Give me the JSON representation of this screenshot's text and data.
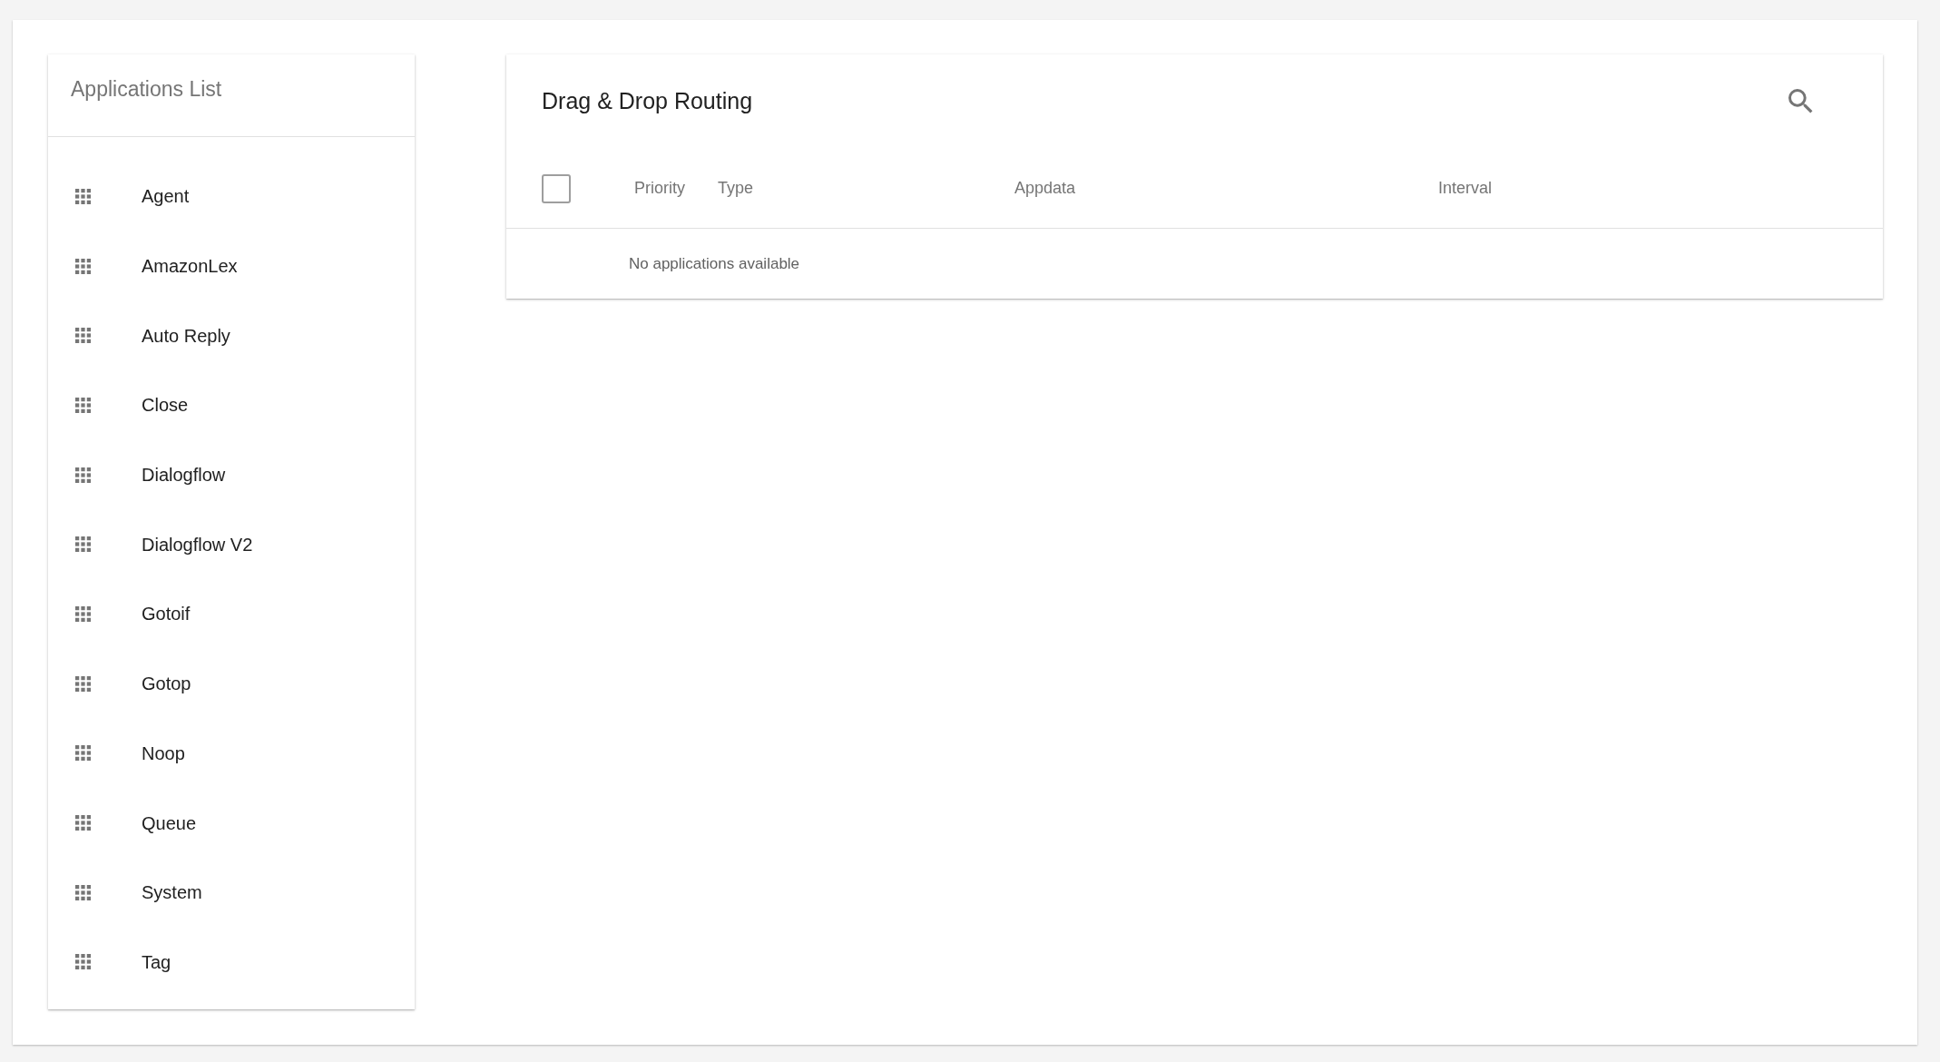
{
  "sidebar": {
    "title": "Applications List",
    "items": [
      {
        "label": "Agent"
      },
      {
        "label": "AmazonLex"
      },
      {
        "label": "Auto Reply"
      },
      {
        "label": "Close"
      },
      {
        "label": "Dialogflow"
      },
      {
        "label": "Dialogflow V2"
      },
      {
        "label": "Gotoif"
      },
      {
        "label": "Gotop"
      },
      {
        "label": "Noop"
      },
      {
        "label": "Queue"
      },
      {
        "label": "System"
      },
      {
        "label": "Tag"
      }
    ]
  },
  "main": {
    "title": "Drag & Drop Routing",
    "table": {
      "select_all": {
        "checked": false
      },
      "columns": [
        "Priority",
        "Type",
        "Appdata",
        "Interval"
      ],
      "empty_message": "No applications available"
    }
  }
}
